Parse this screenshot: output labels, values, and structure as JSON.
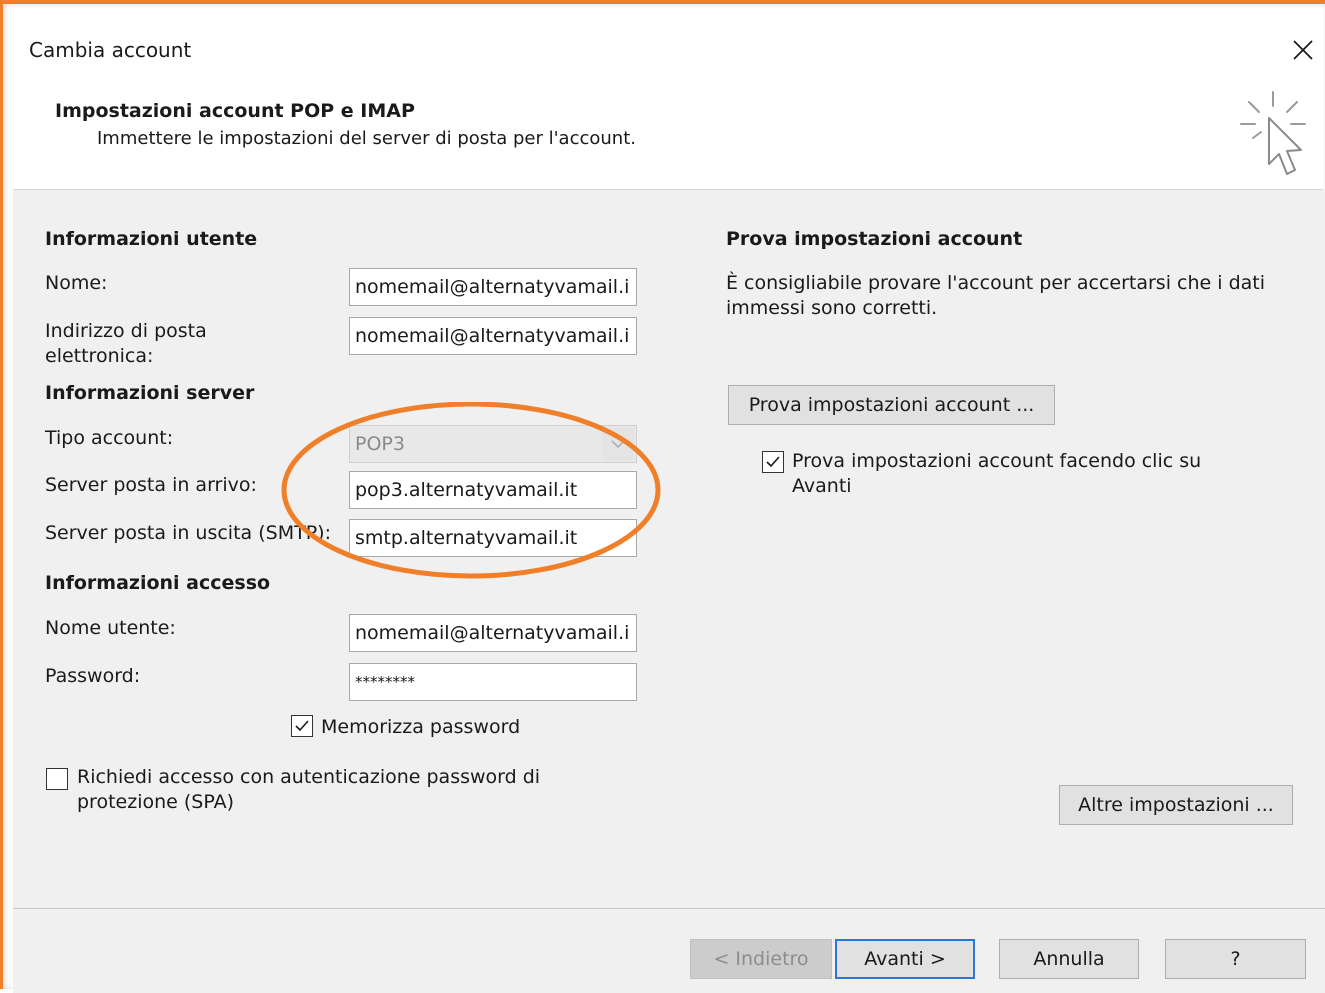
{
  "window": {
    "title": "Cambia account"
  },
  "header": {
    "title": "Impostazioni account POP e IMAP",
    "subtitle": "Immettere le impostazioni del server di posta per l'account."
  },
  "left": {
    "user_section": "Informazioni utente",
    "name_label": "Nome:",
    "name_value": "nomemail@alternatyvamail.i",
    "email_label_1": "Indirizzo di posta",
    "email_label_2": "elettronica:",
    "email_value": "nomemail@alternatyvamail.i",
    "server_section": "Informazioni server",
    "account_type_label": "Tipo account:",
    "account_type_value": "POP3",
    "incoming_label": "Server posta in arrivo:",
    "incoming_value": "pop3.alternatyvamail.it",
    "outgoing_label": "Server posta in uscita (SMTP):",
    "outgoing_value": "smtp.alternatyvamail.it",
    "access_section": "Informazioni accesso",
    "username_label": "Nome utente:",
    "username_value": "nomemail@alternatyvamail.i",
    "password_label": "Password:",
    "password_value": "********",
    "remember_label": "Memorizza password",
    "remember_checked": true,
    "spa_label_1": "Richiedi accesso con autenticazione password di",
    "spa_label_2": "protezione (SPA)",
    "spa_checked": false
  },
  "right": {
    "test_section": "Prova impostazioni account",
    "test_desc_1": "È consigliabile provare l'account per accertarsi che i dati",
    "test_desc_2": "immessi sono corretti.",
    "test_button": "Prova impostazioni account ...",
    "auto_test_label_1": "Prova impostazioni account facendo clic su",
    "auto_test_label_2": "Avanti",
    "auto_test_checked": true,
    "more_settings_button": "Altre impostazioni ..."
  },
  "footer": {
    "back_button": "< Indietro",
    "next_button": "Avanti >",
    "cancel_button": "Annulla",
    "help_button": "?"
  },
  "colors": {
    "annotation": "#f07f2a",
    "dialog_bg": "#f0f0f0",
    "default_button_border": "#2a78d6"
  }
}
